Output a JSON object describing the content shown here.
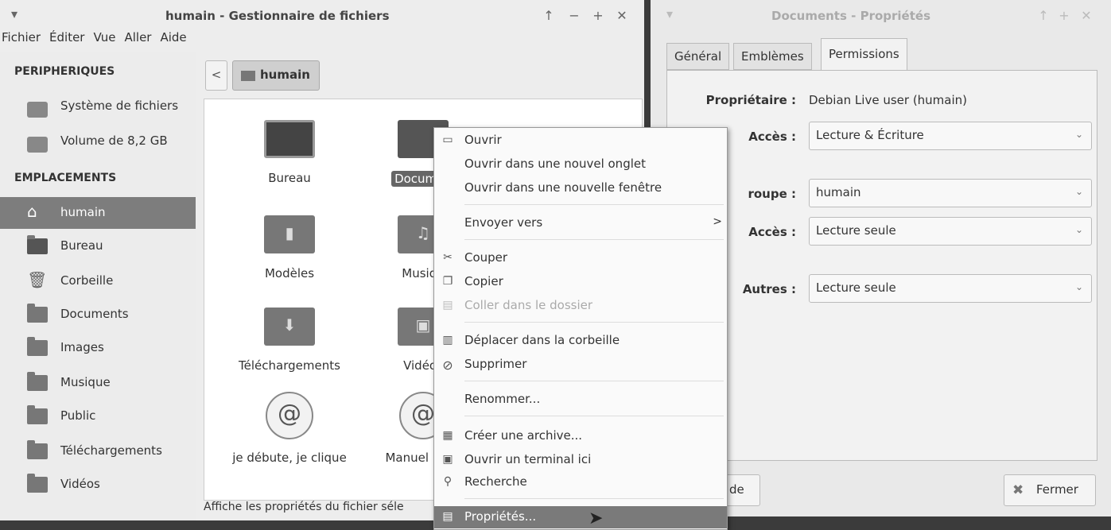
{
  "main_window": {
    "title": "humain - Gestionnaire de fichiers",
    "menu": [
      "Fichier",
      "Éditer",
      "Vue",
      "Aller",
      "Aide"
    ],
    "sidebar": {
      "devices_header": "PERIPHERIQUES",
      "devices": [
        {
          "label": "Système de fichiers",
          "icon": "drive-icon"
        },
        {
          "label": "Volume de 8,2 GB",
          "icon": "drive-icon"
        }
      ],
      "places_header": "EMPLACEMENTS",
      "places": [
        {
          "label": "humain",
          "icon": "home-icon",
          "active": true
        },
        {
          "label": "Bureau",
          "icon": "desktop-icon"
        },
        {
          "label": "Corbeille",
          "icon": "trash-icon"
        },
        {
          "label": "Documents",
          "icon": "folder-icon"
        },
        {
          "label": "Images",
          "icon": "folder-pictures-icon"
        },
        {
          "label": "Musique",
          "icon": "folder-music-icon"
        },
        {
          "label": "Public",
          "icon": "folder-public-icon"
        },
        {
          "label": "Téléchargements",
          "icon": "folder-download-icon"
        },
        {
          "label": "Vidéos",
          "icon": "folder-videos-icon"
        }
      ]
    },
    "pathbar": {
      "back_glyph": "<",
      "current": "humain"
    },
    "files": [
      {
        "label": "Bureau",
        "icon": "desktop-icon"
      },
      {
        "label": "Documen",
        "icon": "folder-icon",
        "selected": true
      },
      {
        "label": "Modèles",
        "icon": "folder-templates-icon"
      },
      {
        "label": "Musiqu",
        "icon": "folder-music-icon"
      },
      {
        "label": "Téléchargements",
        "icon": "folder-download-icon"
      },
      {
        "label": "Vidéos",
        "icon": "folder-videos-icon"
      },
      {
        "label": "je débute, je clique",
        "icon": "debian-book-icon"
      },
      {
        "label": "Manuel utilis",
        "icon": "debian-book-icon"
      }
    ],
    "status": "Affiche les propriétés du fichier séle"
  },
  "context_menu": {
    "items": [
      {
        "label": "Ouvrir",
        "icon": "open-icon"
      },
      {
        "label": "Ouvrir dans une nouvel onglet",
        "icon": ""
      },
      {
        "label": "Ouvrir dans une nouvelle fenêtre",
        "icon": ""
      },
      {
        "label": "Envoyer vers",
        "icon": "",
        "submenu_arrow": ">"
      },
      {
        "label": "Couper",
        "icon": "cut-icon"
      },
      {
        "label": "Copier",
        "icon": "copy-icon"
      },
      {
        "label": "Coller dans le dossier",
        "icon": "paste-icon",
        "disabled": true
      },
      {
        "label": "Déplacer  dans la corbeille",
        "icon": "trash-icon"
      },
      {
        "label": "Supprimer",
        "icon": "delete-icon"
      },
      {
        "label": "Renommer...",
        "icon": ""
      },
      {
        "label": "Créer une archive...",
        "icon": "archive-icon"
      },
      {
        "label": "Ouvrir un terminal ici",
        "icon": "terminal-icon"
      },
      {
        "label": "Recherche",
        "icon": "search-icon"
      },
      {
        "label": "Propriétés...",
        "icon": "properties-icon",
        "highlighted": true
      }
    ]
  },
  "props_window": {
    "title": "Documents - Propriétés",
    "tabs": [
      "Général",
      "Emblèmes",
      "Permissions"
    ],
    "active_tab": "Permissions",
    "owner_label": "Propriétaire :",
    "owner_value": "Debian Live user (humain)",
    "owner_access_label": "Accès :",
    "owner_access_value": "Lecture & Écriture",
    "group_label": "roupe :",
    "group_value": "humain",
    "group_access_label": "Accès :",
    "group_access_value": "Lecture seule",
    "others_label": "Autres :",
    "others_access_value": "Lecture seule",
    "help_button_partial": "de",
    "close_button": "Fermer"
  }
}
